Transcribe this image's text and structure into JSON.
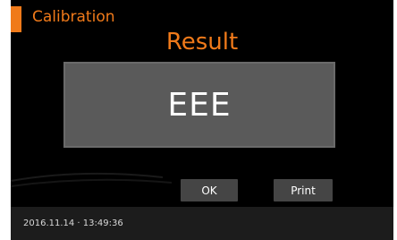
{
  "header": {
    "title": "Calibration"
  },
  "result": {
    "title": "Result",
    "value": "EEE"
  },
  "buttons": {
    "ok_label": "OK",
    "print_label": "Print"
  },
  "footer": {
    "datetime": "2016.11.14 · 13:49:36"
  },
  "colors": {
    "accent": "#f07a1a",
    "background": "#000000",
    "result_box": "#5a5a5a",
    "button": "#454545",
    "footer": "#1c1c1c"
  }
}
